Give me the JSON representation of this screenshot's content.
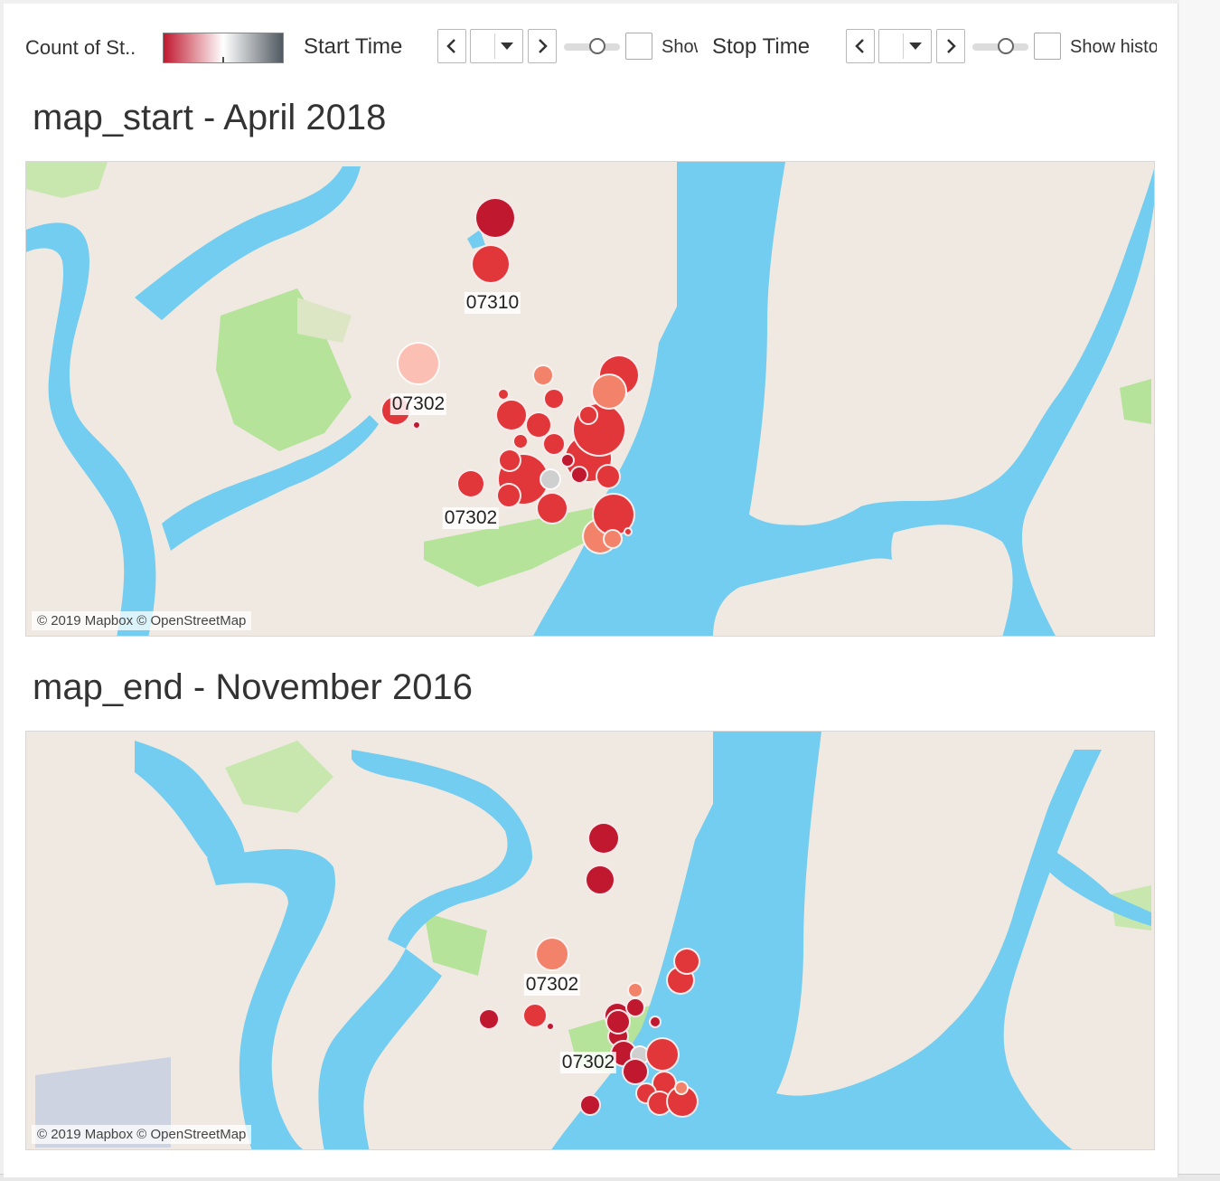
{
  "toolbar": {
    "legend_title": "Count of St..",
    "start_time_label": "Start Time",
    "start_show_label": "Show history",
    "stop_time_label": "Stop Time",
    "stop_show_label": "Show history"
  },
  "colors": {
    "water": "#72cdf0",
    "land": "#efe9e2",
    "park": "#b5e39a",
    "mark_dark": "#c0182f",
    "mark_mid": "#e2373a",
    "mark_light": "#f3826a",
    "mark_pale": "#fbbfb3",
    "mark_null": "#cfcfcf"
  },
  "map_start": {
    "title": "map_start - April 2018",
    "attribution": "© 2019 Mapbox © OpenStreetMap",
    "labels": [
      "07310",
      "07302",
      "07302"
    ],
    "marks": [
      {
        "lon": 0.416,
        "lat": 0.882,
        "size": 46,
        "color": "mark_dark"
      },
      {
        "lon": 0.412,
        "lat": 0.785,
        "size": 44,
        "color": "mark_mid"
      },
      {
        "lon": 0.348,
        "lat": 0.575,
        "size": 48,
        "color": "mark_pale"
      },
      {
        "lon": 0.328,
        "lat": 0.475,
        "size": 34,
        "color": "mark_mid"
      },
      {
        "lon": 0.346,
        "lat": 0.445,
        "size": 10,
        "color": "mark_dark"
      },
      {
        "lon": 0.43,
        "lat": 0.465,
        "size": 36,
        "color": "mark_mid"
      },
      {
        "lon": 0.454,
        "lat": 0.445,
        "size": 30,
        "color": "mark_mid"
      },
      {
        "lon": 0.458,
        "lat": 0.55,
        "size": 24,
        "color": "mark_light"
      },
      {
        "lon": 0.468,
        "lat": 0.5,
        "size": 24,
        "color": "mark_mid"
      },
      {
        "lon": 0.438,
        "lat": 0.41,
        "size": 18,
        "color": "mark_mid"
      },
      {
        "lon": 0.423,
        "lat": 0.51,
        "size": 14,
        "color": "mark_mid"
      },
      {
        "lon": 0.468,
        "lat": 0.405,
        "size": 26,
        "color": "mark_mid"
      },
      {
        "lon": 0.441,
        "lat": 0.33,
        "size": 58,
        "color": "mark_mid"
      },
      {
        "lon": 0.465,
        "lat": 0.33,
        "size": 24,
        "color": "mark_null"
      },
      {
        "lon": 0.428,
        "lat": 0.295,
        "size": 28,
        "color": "mark_mid"
      },
      {
        "lon": 0.498,
        "lat": 0.375,
        "size": 54,
        "color": "mark_mid"
      },
      {
        "lon": 0.508,
        "lat": 0.435,
        "size": 60,
        "color": "mark_mid"
      },
      {
        "lon": 0.526,
        "lat": 0.55,
        "size": 46,
        "color": "mark_mid"
      },
      {
        "lon": 0.517,
        "lat": 0.515,
        "size": 40,
        "color": "mark_light"
      },
      {
        "lon": 0.498,
        "lat": 0.465,
        "size": 22,
        "color": "mark_mid"
      },
      {
        "lon": 0.49,
        "lat": 0.34,
        "size": 20,
        "color": "mark_dark"
      },
      {
        "lon": 0.516,
        "lat": 0.335,
        "size": 28,
        "color": "mark_mid"
      },
      {
        "lon": 0.509,
        "lat": 0.21,
        "size": 40,
        "color": "mark_light"
      },
      {
        "lon": 0.521,
        "lat": 0.255,
        "size": 48,
        "color": "mark_mid"
      },
      {
        "lon": 0.52,
        "lat": 0.205,
        "size": 22,
        "color": "mark_light"
      },
      {
        "lon": 0.534,
        "lat": 0.22,
        "size": 10,
        "color": "mark_mid"
      },
      {
        "lon": 0.466,
        "lat": 0.27,
        "size": 36,
        "color": "mark_mid"
      },
      {
        "lon": 0.429,
        "lat": 0.37,
        "size": 26,
        "color": "mark_mid"
      },
      {
        "lon": 0.394,
        "lat": 0.32,
        "size": 32,
        "color": "mark_mid"
      },
      {
        "lon": 0.48,
        "lat": 0.37,
        "size": 16,
        "color": "mark_dark"
      }
    ]
  },
  "map_end": {
    "title": "map_end - November 2016",
    "attribution": "© 2019 Mapbox © OpenStreetMap",
    "labels": [
      "07302",
      "07302"
    ],
    "marks": [
      {
        "lon": 0.512,
        "lat": 0.745,
        "size": 36,
        "color": "mark_dark"
      },
      {
        "lon": 0.509,
        "lat": 0.645,
        "size": 34,
        "color": "mark_dark"
      },
      {
        "lon": 0.466,
        "lat": 0.467,
        "size": 38,
        "color": "mark_light"
      },
      {
        "lon": 0.451,
        "lat": 0.32,
        "size": 28,
        "color": "mark_mid"
      },
      {
        "lon": 0.465,
        "lat": 0.295,
        "size": 10,
        "color": "mark_dark"
      },
      {
        "lon": 0.41,
        "lat": 0.312,
        "size": 24,
        "color": "mark_dark"
      },
      {
        "lon": 0.524,
        "lat": 0.32,
        "size": 30,
        "color": "mark_dark"
      },
      {
        "lon": 0.54,
        "lat": 0.34,
        "size": 22,
        "color": "mark_dark"
      },
      {
        "lon": 0.54,
        "lat": 0.38,
        "size": 18,
        "color": "mark_light"
      },
      {
        "lon": 0.525,
        "lat": 0.27,
        "size": 24,
        "color": "mark_dark"
      },
      {
        "lon": 0.53,
        "lat": 0.23,
        "size": 30,
        "color": "mark_dark"
      },
      {
        "lon": 0.544,
        "lat": 0.226,
        "size": 22,
        "color": "mark_null"
      },
      {
        "lon": 0.54,
        "lat": 0.186,
        "size": 30,
        "color": "mark_dark"
      },
      {
        "lon": 0.564,
        "lat": 0.228,
        "size": 38,
        "color": "mark_mid"
      },
      {
        "lon": 0.566,
        "lat": 0.157,
        "size": 28,
        "color": "mark_mid"
      },
      {
        "lon": 0.55,
        "lat": 0.135,
        "size": 24,
        "color": "mark_mid"
      },
      {
        "lon": 0.562,
        "lat": 0.11,
        "size": 28,
        "color": "mark_mid"
      },
      {
        "lon": 0.582,
        "lat": 0.115,
        "size": 36,
        "color": "mark_mid"
      },
      {
        "lon": 0.581,
        "lat": 0.148,
        "size": 16,
        "color": "mark_light"
      },
      {
        "lon": 0.58,
        "lat": 0.405,
        "size": 32,
        "color": "mark_mid"
      },
      {
        "lon": 0.586,
        "lat": 0.45,
        "size": 30,
        "color": "mark_mid"
      },
      {
        "lon": 0.5,
        "lat": 0.105,
        "size": 24,
        "color": "mark_dark"
      },
      {
        "lon": 0.525,
        "lat": 0.305,
        "size": 28,
        "color": "mark_dark"
      },
      {
        "lon": 0.558,
        "lat": 0.305,
        "size": 14,
        "color": "mark_dark"
      }
    ]
  }
}
